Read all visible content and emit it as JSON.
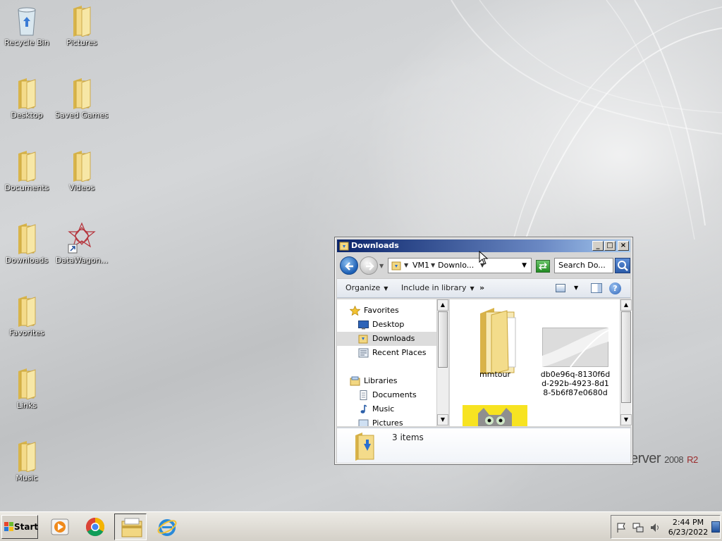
{
  "desktop": {
    "icons": [
      {
        "label": "Recycle Bin",
        "icon": "recycle-bin-icon"
      },
      {
        "label": "Pictures",
        "icon": "folder-icon"
      },
      {
        "label": "Desktop",
        "icon": "folder-icon"
      },
      {
        "label": "Saved Games",
        "icon": "folder-icon"
      },
      {
        "label": "Documents",
        "icon": "folder-icon"
      },
      {
        "label": "Videos",
        "icon": "folder-icon"
      },
      {
        "label": "Downloads",
        "icon": "folder-icon"
      },
      {
        "label": "DataWagon...",
        "icon": "datawagon-shortcut-icon"
      },
      {
        "label": "Favorites",
        "icon": "folder-icon"
      },
      {
        "label": "Links",
        "icon": "folder-icon"
      },
      {
        "label": "Music",
        "icon": "folder-icon"
      }
    ],
    "brand": {
      "text": "erver",
      "version": "2008",
      "edition": "R2"
    }
  },
  "explorer": {
    "title": "Downloads",
    "address": {
      "crumbs": [
        "VM1",
        "Downlo..."
      ]
    },
    "search_placeholder": "Search Do...",
    "commands": {
      "organize": "Organize",
      "include": "Include in library",
      "more": "»"
    },
    "nav": {
      "favorites": "Favorites",
      "desktop": "Desktop",
      "downloads": "Downloads",
      "recent": "Recent Places",
      "libraries": "Libraries",
      "documents": "Documents",
      "music": "Music",
      "pictures": "Pictures"
    },
    "files": [
      {
        "name": "mmtour",
        "type": "folder"
      },
      {
        "name": "db0e96q-8130f6dd-292b-4923-8d18-5b6f87e0680d",
        "type": "image"
      },
      {
        "name": "",
        "type": "image-cat"
      }
    ],
    "status": {
      "count": "3 items"
    }
  },
  "taskbar": {
    "start_label": "Start",
    "apps": [
      "media-player-icon",
      "chrome-icon",
      "explorer-icon",
      "internet-explorer-icon"
    ],
    "clock": {
      "time": "2:44 PM",
      "date": "6/23/2022"
    }
  }
}
